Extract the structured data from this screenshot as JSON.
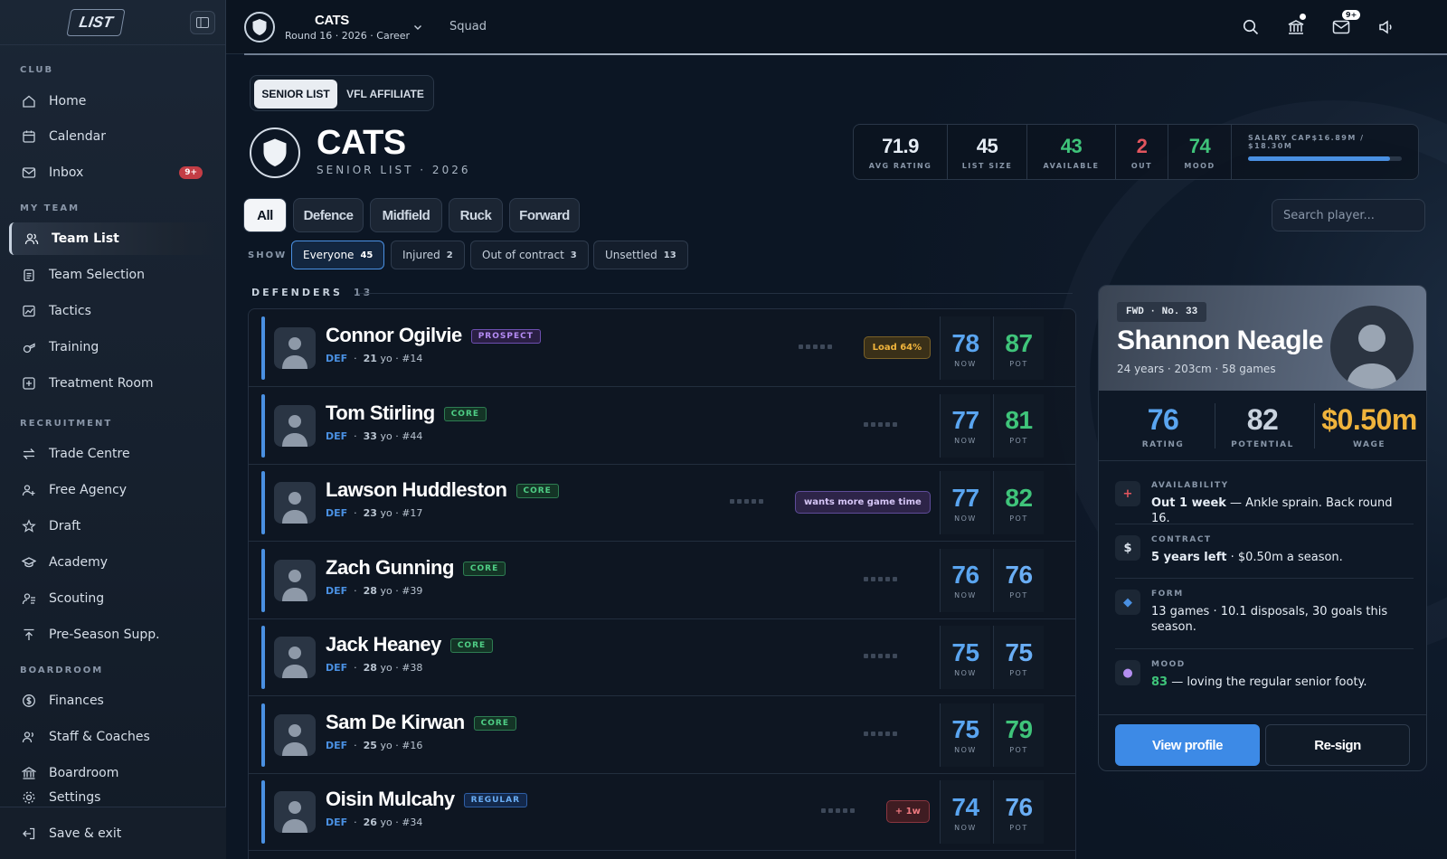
{
  "sidebar": {
    "logo": "LIST",
    "sections": [
      {
        "title": "CLUB"
      },
      {
        "title": "MY TEAM"
      },
      {
        "title": "RECRUITMENT"
      },
      {
        "title": "BOARDROOM"
      }
    ],
    "items": [
      {
        "label": "Home",
        "icon": "home-icon"
      },
      {
        "label": "Calendar",
        "icon": "calendar-icon"
      },
      {
        "label": "Inbox",
        "icon": "mail-icon",
        "badge": "9+"
      },
      {
        "label": "Team List",
        "icon": "users-icon",
        "active": true
      },
      {
        "label": "Team Selection",
        "icon": "clipboard-icon"
      },
      {
        "label": "Tactics",
        "icon": "chart-icon"
      },
      {
        "label": "Training",
        "icon": "whistle-icon"
      },
      {
        "label": "Treatment Room",
        "icon": "medical-icon"
      },
      {
        "label": "Trade Centre",
        "icon": "swap-icon"
      },
      {
        "label": "Free Agency",
        "icon": "user-plus-icon"
      },
      {
        "label": "Draft",
        "icon": "star-icon"
      },
      {
        "label": "Academy",
        "icon": "graduation-icon"
      },
      {
        "label": "Scouting",
        "icon": "binoculars-icon"
      },
      {
        "label": "Pre-Season Supp.",
        "icon": "upload-icon"
      },
      {
        "label": "Finances",
        "icon": "dollar-icon"
      },
      {
        "label": "Staff & Coaches",
        "icon": "staff-icon"
      },
      {
        "label": "Boardroom",
        "icon": "bank-icon"
      },
      {
        "label": "Settings",
        "icon": "settings-icon"
      }
    ],
    "save_exit": "Save & exit"
  },
  "topbar": {
    "team": "CATS",
    "subtitle": "Round 16 · 2026 · Career",
    "squad": "Squad",
    "inbox_badge": "9+"
  },
  "list_tabs": [
    "SENIOR LIST",
    "VFL AFFILIATE"
  ],
  "team": {
    "name": "CATS",
    "subtitle": "SENIOR LIST · 2026"
  },
  "stats": [
    {
      "value": "71.9",
      "label": "AVG RATING",
      "color": "#ffffff"
    },
    {
      "value": "45",
      "label": "LIST SIZE",
      "color": "#ffffff"
    },
    {
      "value": "43",
      "label": "AVAILABLE",
      "color": "#3fc47a"
    },
    {
      "value": "2",
      "label": "OUT",
      "color": "#e2555e"
    },
    {
      "value": "74",
      "label": "MOOD",
      "color": "#3fc47a"
    }
  ],
  "salary": {
    "label": "SALARY CAP",
    "value": "$16.89M / $18.30M",
    "fill": 0.923
  },
  "positions": [
    "All",
    "Defence",
    "Midfield",
    "Ruck",
    "Forward"
  ],
  "search": {
    "placeholder": "Search player..."
  },
  "show": {
    "label": "SHOW",
    "chips": [
      {
        "label": "Everyone",
        "count": "45"
      },
      {
        "label": "Injured",
        "count": "2"
      },
      {
        "label": "Out of contract",
        "count": "3"
      },
      {
        "label": "Unsettled",
        "count": "13"
      }
    ]
  },
  "group": {
    "label": "DEFENDERS",
    "count": "13"
  },
  "players": [
    {
      "name": "Connor Ogilvie",
      "tag": "PROSPECT",
      "pos": "DEF",
      "age": "21",
      "age_unit": "yo",
      "num": "#14",
      "note": "Load 64%",
      "note_type": "load",
      "now": "78",
      "pot": "87"
    },
    {
      "name": "Tom Stirling",
      "tag": "CORE",
      "pos": "DEF",
      "age": "33",
      "age_unit": "yo",
      "num": "#44",
      "note": "",
      "note_type": "",
      "now": "77",
      "pot": "81"
    },
    {
      "name": "Lawson Huddleston",
      "tag": "CORE",
      "pos": "DEF",
      "age": "23",
      "age_unit": "yo",
      "num": "#17",
      "note": "wants more game time",
      "note_type": "mood",
      "now": "77",
      "pot": "82"
    },
    {
      "name": "Zach Gunning",
      "tag": "CORE",
      "pos": "DEF",
      "age": "28",
      "age_unit": "yo",
      "num": "#39",
      "note": "",
      "note_type": "",
      "now": "76",
      "pot": "76"
    },
    {
      "name": "Jack Heaney",
      "tag": "CORE",
      "pos": "DEF",
      "age": "28",
      "age_unit": "yo",
      "num": "#38",
      "note": "",
      "note_type": "",
      "now": "75",
      "pot": "75"
    },
    {
      "name": "Sam De Kirwan",
      "tag": "CORE",
      "pos": "DEF",
      "age": "25",
      "age_unit": "yo",
      "num": "#16",
      "note": "",
      "note_type": "",
      "now": "75",
      "pot": "79"
    },
    {
      "name": "Oisin Mulcahy",
      "tag": "REGULAR",
      "pos": "DEF",
      "age": "26",
      "age_unit": "yo",
      "num": "#34",
      "note": "+ 1w",
      "note_type": "injury",
      "now": "74",
      "pot": "76"
    }
  ],
  "score_labels": {
    "now": "NOW",
    "pot": "POT"
  },
  "detail": {
    "pos": "FWD · No. 33",
    "name": "Shannon Neagle",
    "sub": "24 years · 203cm · 58 games",
    "rating": "76",
    "rating_label": "RATING",
    "potential": "82",
    "potential_label": "POTENTIAL",
    "wage": "$0.50m",
    "wage_label": "WAGE",
    "availability": {
      "title": "AVAILABILITY",
      "strong": "Out 1 week",
      "rest": " — Ankle sprain. Back round 16."
    },
    "contract": {
      "title": "CONTRACT",
      "strong": "5 years left",
      "rest": " · $0.50m a season."
    },
    "form": {
      "title": "FORM",
      "text": "13 games · 10.1 disposals, 30 goals this season."
    },
    "mood": {
      "title": "MOOD",
      "strong": "83",
      "rest": " — loving the regular senior footy."
    },
    "view_profile": "View profile",
    "resign": "Re-sign"
  },
  "colors": {
    "accent": "#4a90e2",
    "green": "#3fc47a",
    "red": "#e2555e",
    "gold": "#f0b43c"
  }
}
